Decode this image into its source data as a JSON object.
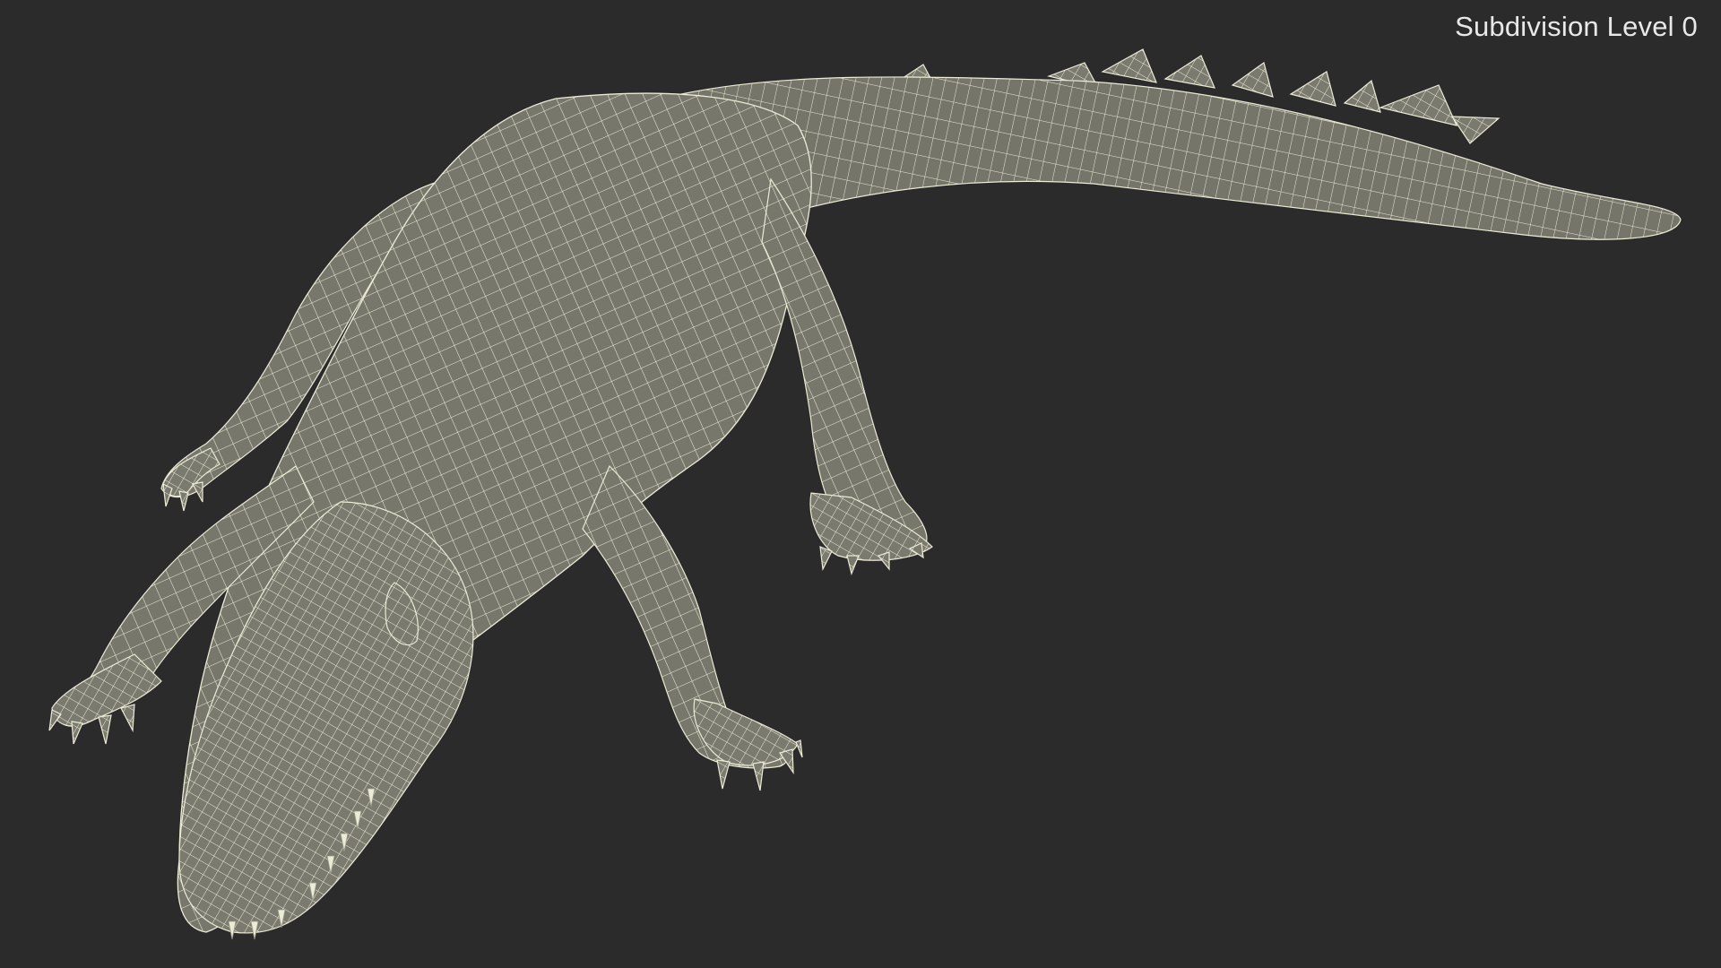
{
  "viewport": {
    "label": "Subdivision Level 0",
    "background": "#2b2b2b"
  },
  "model": {
    "subject": "crocodile-wireframe",
    "surface_color": "#77776c",
    "wire_color": "#ecebd6"
  }
}
